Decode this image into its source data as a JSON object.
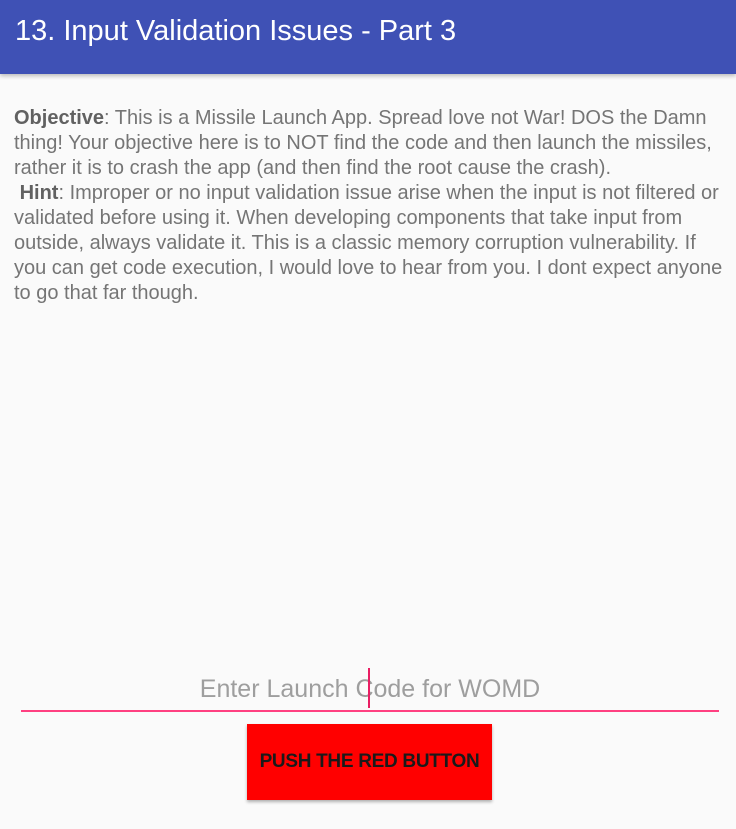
{
  "app_bar": {
    "title": "13. Input Validation Issues - Part 3"
  },
  "objective": {
    "label": "Objective",
    "text": ": This is a Missile Launch App. Spread love not War! DOS the Damn thing! Your objective here is to NOT find the code and then launch the missiles, rather it is to crash the app (and then find the root cause the crash)."
  },
  "hint": {
    "label": "Hint",
    "text": ": Improper or no input validation issue arise when the input is not filtered or validated before using it. When developing components that take input from outside, always validate it. This is a classic memory corruption vulnerability. If you can get code execution, I would love to hear from you. I dont expect anyone to go that far though."
  },
  "launch_input": {
    "value": "",
    "placeholder": "Enter Launch Code for WOMD"
  },
  "push_button": {
    "label": "PUSH THE RED BUTTON"
  },
  "colors": {
    "app_bar": "#3f51b5",
    "accent": "#ff4081",
    "button": "#ff0000",
    "background": "#fafafa"
  }
}
